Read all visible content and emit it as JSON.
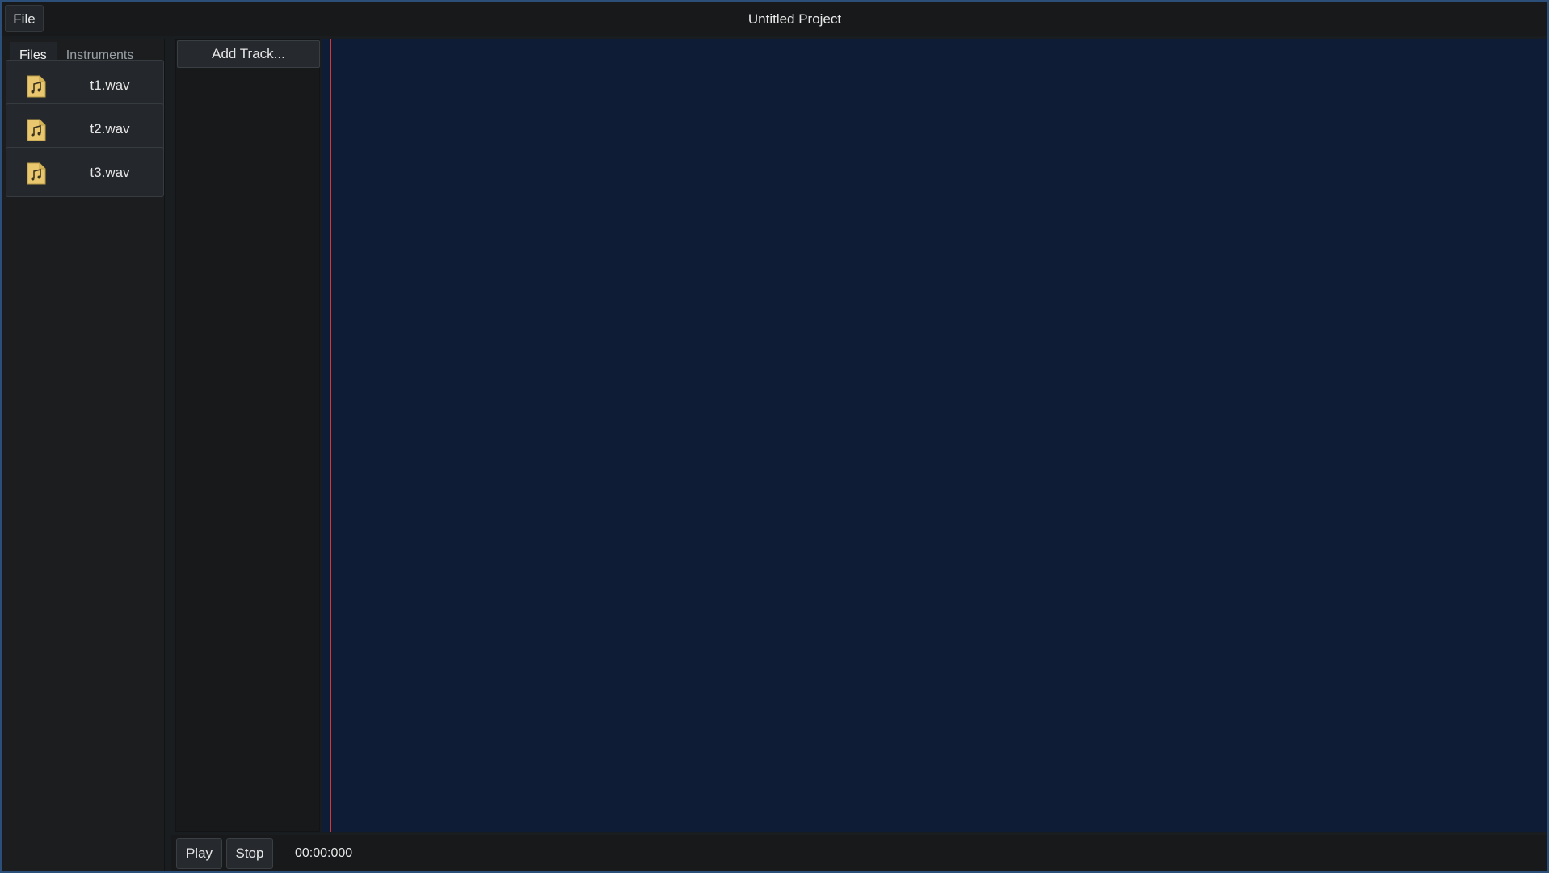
{
  "window": {
    "title": "Untitled Project"
  },
  "menu": {
    "file_label": "File"
  },
  "sidebar": {
    "tabs": [
      {
        "label": "Files",
        "active": true
      },
      {
        "label": "Instruments",
        "active": false
      }
    ],
    "files": [
      {
        "name": "t1.wav",
        "icon": "audio-file-icon"
      },
      {
        "name": "t2.wav",
        "icon": "audio-file-icon"
      },
      {
        "name": "t3.wav",
        "icon": "audio-file-icon"
      }
    ]
  },
  "tracks": {
    "add_track_label": "Add Track..."
  },
  "transport": {
    "play_label": "Play",
    "stop_label": "Stop",
    "time": "00:00:000"
  },
  "colors": {
    "accent": "#4a90d9",
    "playhead": "#d23a3a",
    "timeline_bg": "#0f1c36",
    "file_icon": "#e8c76e"
  }
}
